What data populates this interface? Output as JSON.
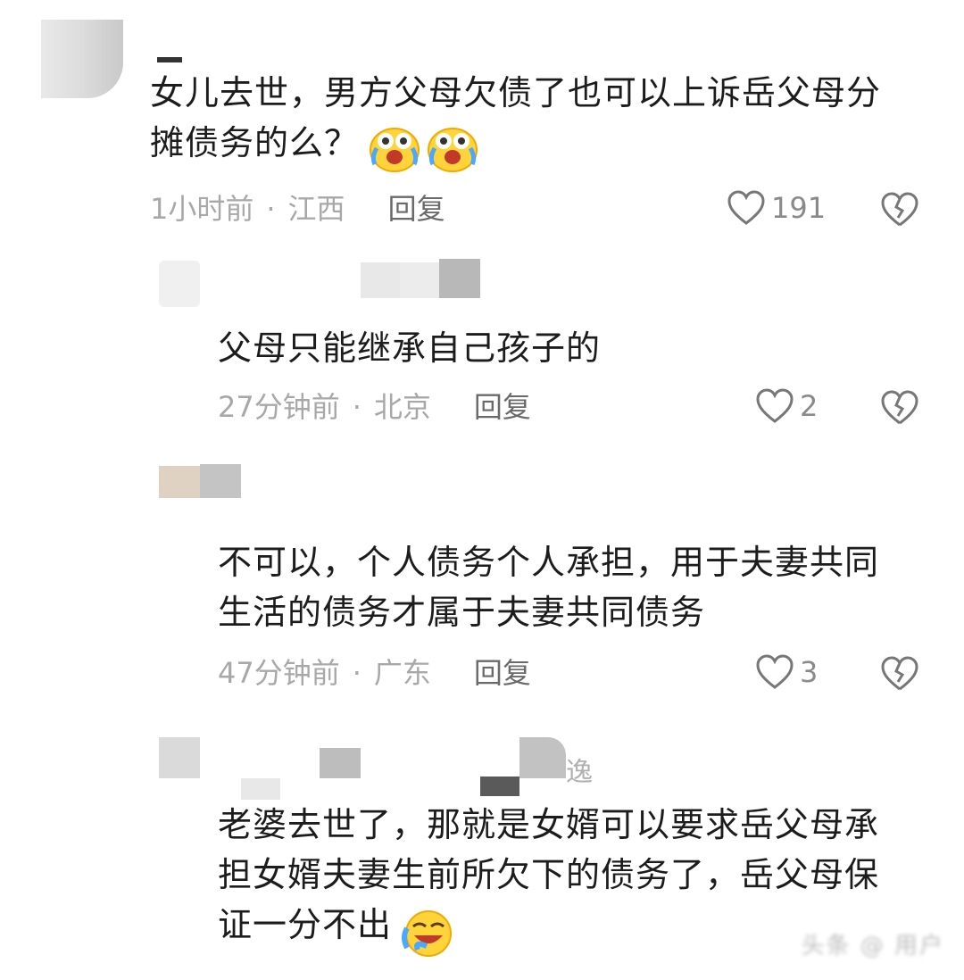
{
  "comments": [
    {
      "text": "女儿去世，男方父母欠债了也可以上诉岳父母分\n摊债务的么？",
      "emojis": [
        "crying-laughing-emoji",
        "crying-laughing-emoji"
      ],
      "time": "1小时前",
      "sep": "·",
      "region": "江西",
      "reply": "回复",
      "likes": "191"
    },
    {
      "text": "父母只能继承自己孩子的",
      "time": "27分钟前",
      "sep": "·",
      "region": "北京",
      "reply": "回复",
      "likes": "2"
    },
    {
      "text": "不可以，个人债务个人承担，用于夫妻共同\n生活的债务才属于夫妻共同债务",
      "time": "47分钟前",
      "sep": "·",
      "region": "广东",
      "reply": "回复",
      "likes": "3"
    },
    {
      "username_fragment": "逸",
      "text": "老婆去世了，那就是女婿可以要求岳父母承\n担女婿夫妻生前所欠下的债务了，岳父母保\n证一分不出",
      "emojis": [
        "rofl-emoji"
      ]
    }
  ],
  "watermark": "头条 @ 用户",
  "icons": {
    "like": "heart-outline-icon",
    "dislike": "broken-heart-icon"
  }
}
